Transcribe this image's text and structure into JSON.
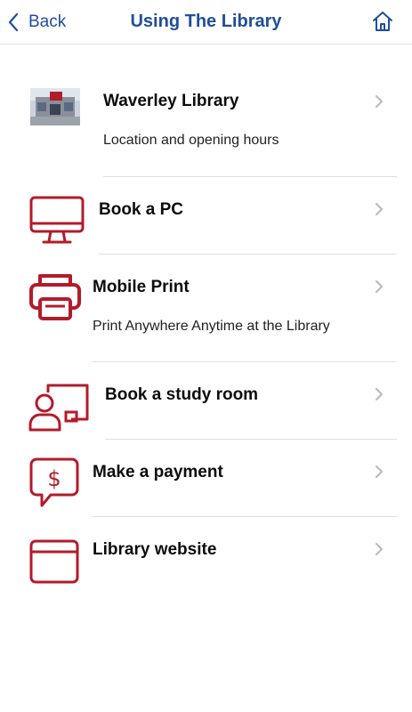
{
  "nav": {
    "back_label": "Back",
    "title": "Using The Library",
    "back_icon": "chevron-left-icon",
    "home_icon": "home-icon"
  },
  "colors": {
    "accent": "#1f4e9c",
    "icon_red": "#b31b2a",
    "divider": "#dedede",
    "chevron": "#b9b9bd"
  },
  "items": [
    {
      "label": "Waverley Library",
      "sub": "Location and opening hours",
      "icon": "library-photo"
    },
    {
      "label": "Book a PC",
      "icon": "monitor-icon"
    },
    {
      "label": "Mobile Print",
      "sub": "Print Anywhere Anytime at the Library",
      "icon": "printer-icon"
    },
    {
      "label": "Book a study room",
      "icon": "study-room-icon"
    },
    {
      "label": "Make a payment",
      "icon": "payment-icon"
    },
    {
      "label": "Library website",
      "icon": "browser-window-icon"
    }
  ]
}
